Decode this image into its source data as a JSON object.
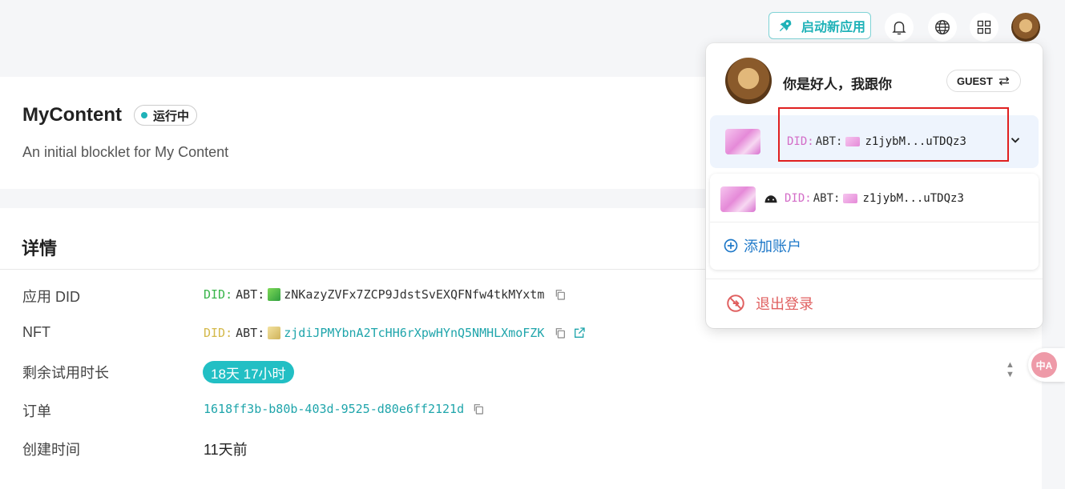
{
  "header": {
    "launch_label": "启动新应用",
    "icons": [
      "rocket-icon",
      "bell-icon",
      "globe-icon",
      "grid-icon"
    ]
  },
  "app": {
    "name": "MyContent",
    "status": "运行中",
    "description": "An initial blocklet for My Content"
  },
  "details": {
    "section_title": "详情",
    "rows": {
      "did": {
        "label": "应用 DID",
        "prefix": "DID:",
        "abt": "ABT:",
        "value": "zNKazyZVFx7ZCP9JdstSvEXQFNfw4tkMYxtm"
      },
      "nft": {
        "label": "NFT",
        "prefix": "DID:",
        "abt": "ABT:",
        "value": "zjdiJPMYbnA2TcHH6rXpwHYnQ5NMHLXmoFZK"
      },
      "trial": {
        "label": "剩余试用时长",
        "value": "18天 17小时"
      },
      "order": {
        "label": "订单",
        "value": "1618ff3b-b80b-403d-9525-d80e6ff2121d"
      },
      "created": {
        "label": "创建时间",
        "value": "11天前"
      }
    }
  },
  "user_menu": {
    "username": "你是好人，我跟你",
    "role": "GUEST",
    "current_account": {
      "prefix": "DID:",
      "abt": "ABT:",
      "value": "z1jybM...uTDQz3"
    },
    "accounts": [
      {
        "prefix": "DID:",
        "abt": "ABT:",
        "value": "z1jybM...uTDQz3"
      }
    ],
    "add_account": "添加账户",
    "logout": "退出登录"
  },
  "translate_widget": {
    "label": "中A"
  },
  "colors": {
    "accent": "#1fb2b8",
    "link": "#1e78c8",
    "danger": "#e06060",
    "highlight": "#e02020"
  }
}
